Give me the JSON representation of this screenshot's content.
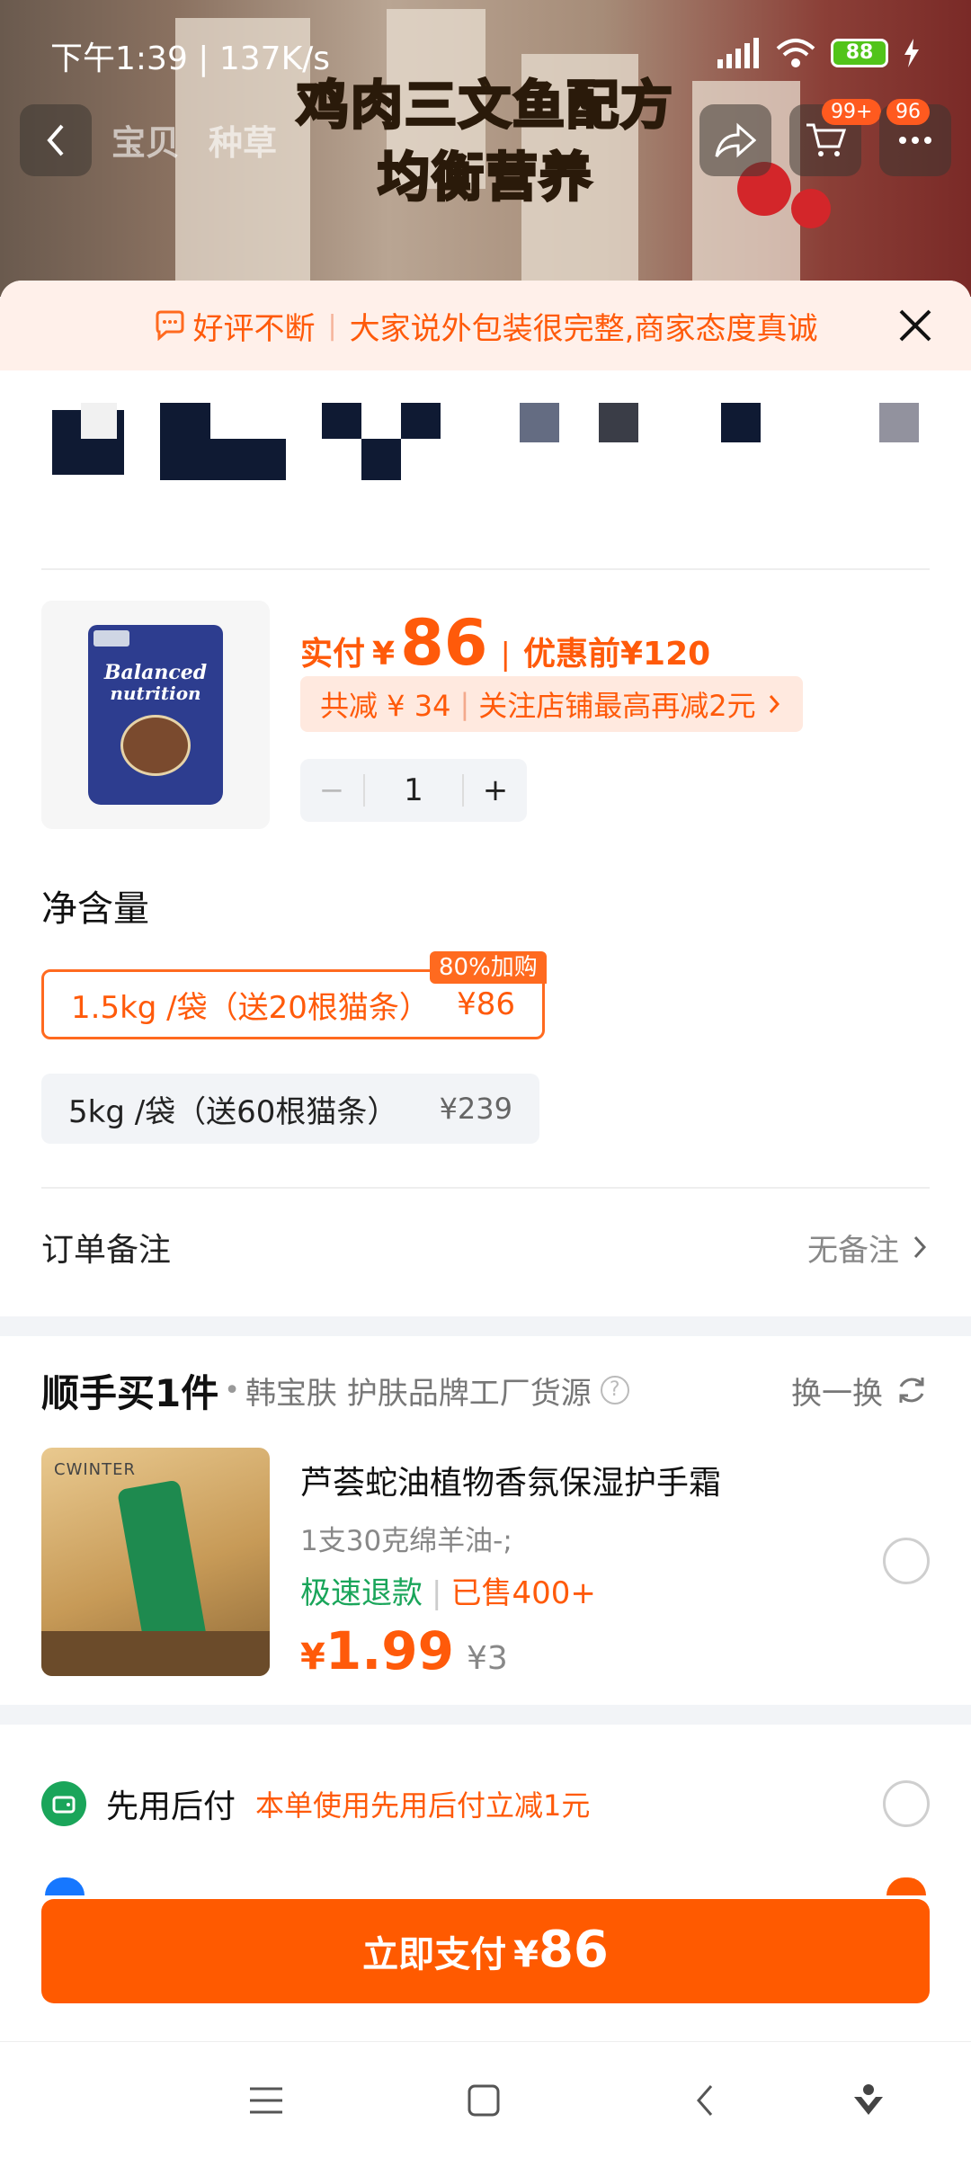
{
  "status_bar": {
    "time": "下午1:39 | 137K/s",
    "battery": "88"
  },
  "hero": {
    "headline_line1": "鸡肉三文鱼配方",
    "headline_line2": "均衡营养"
  },
  "top_nav": {
    "tabs": [
      "宝贝",
      "种草"
    ],
    "cart_badge": "99+",
    "more_badge": "96"
  },
  "notice": {
    "title": "好评不断",
    "text": "大家说外包装很完整,商家态度真诚"
  },
  "product": {
    "bag_line1": "Balanced",
    "bag_line2": "nutrition",
    "paid_label": "实付",
    "currency": "¥",
    "paid_amount": "86",
    "before_label": "优惠前",
    "before_price": "¥120",
    "saving_text": "共减 ¥ 34",
    "saving_follow": "关注店铺最高再减2元",
    "quantity": "1"
  },
  "spec": {
    "title": "净含量",
    "options": [
      {
        "label": "1.5kg /袋（送20根猫条）",
        "price": "¥86",
        "selected": true
      },
      {
        "label": "5kg /袋（送60根猫条）",
        "price": "¥239",
        "selected": false
      }
    ],
    "hot_tag": "80%加购"
  },
  "order_note": {
    "label": "订单备注",
    "value": "无备注"
  },
  "addon": {
    "brand": "顺手买1件",
    "desc": "韩宝肤 护肤品牌工厂货源",
    "swap_label": "换一换",
    "item": {
      "brand_text": "CWINTER",
      "title": "芦荟蛇油植物香氛保湿护手霜",
      "spec": "1支30克绵羊油-;",
      "tag_refund": "极速退款",
      "tag_sold": "已售400+",
      "price_symbol": "¥",
      "price": "1.99",
      "orig_price": "¥3"
    }
  },
  "payment": {
    "method_name": "先用后付",
    "method_promo": "本单使用先用后付立减1元"
  },
  "pay_button": {
    "label": "立即支付",
    "symbol": "¥",
    "amount": "86"
  },
  "colors": {
    "accent": "#ff5a00",
    "green": "#1aa55a"
  }
}
